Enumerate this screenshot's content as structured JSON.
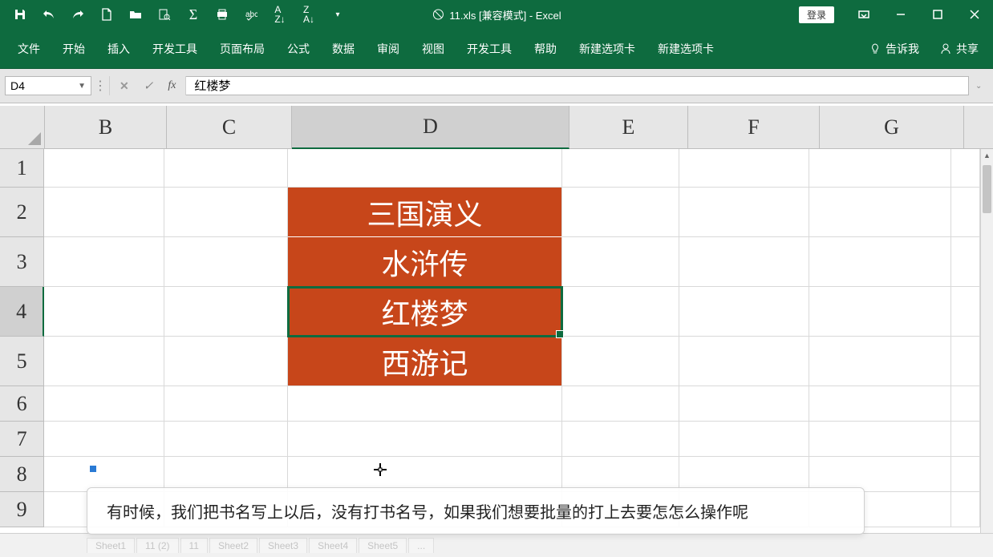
{
  "title": "11.xls [兼容模式] - Excel",
  "login_label": "登录",
  "ribbon_tabs": [
    "文件",
    "开始",
    "插入",
    "开发工具",
    "页面布局",
    "公式",
    "数据",
    "审阅",
    "视图",
    "开发工具",
    "帮助",
    "新建选项卡",
    "新建选项卡"
  ],
  "tell_me": "告诉我",
  "share": "共享",
  "namebox": "D4",
  "formula": "红楼梦",
  "columns": [
    "B",
    "C",
    "D",
    "E",
    "F",
    "G"
  ],
  "rows": [
    "1",
    "2",
    "3",
    "4",
    "5",
    "6",
    "7",
    "8",
    "9"
  ],
  "selected_col": "D",
  "selected_row": "4",
  "cells": {
    "D2": "三国演义",
    "D3": "水浒传",
    "D4": "红楼梦",
    "D5": "西游记"
  },
  "row_heights": {
    "1": 48,
    "2": 62,
    "3": 62,
    "4": 62,
    "5": 62,
    "6": 44,
    "7": 44,
    "8": 44,
    "9": 44
  },
  "sheet_tabs": [
    "Sheet1",
    "11 (2)",
    "11",
    "Sheet2",
    "Sheet3",
    "Sheet4",
    "Sheet5",
    "..."
  ],
  "caption": "有时候，我们把书名写上以后，没有打书名号，如果我们想要批量的打上去要怎怎么操作呢"
}
